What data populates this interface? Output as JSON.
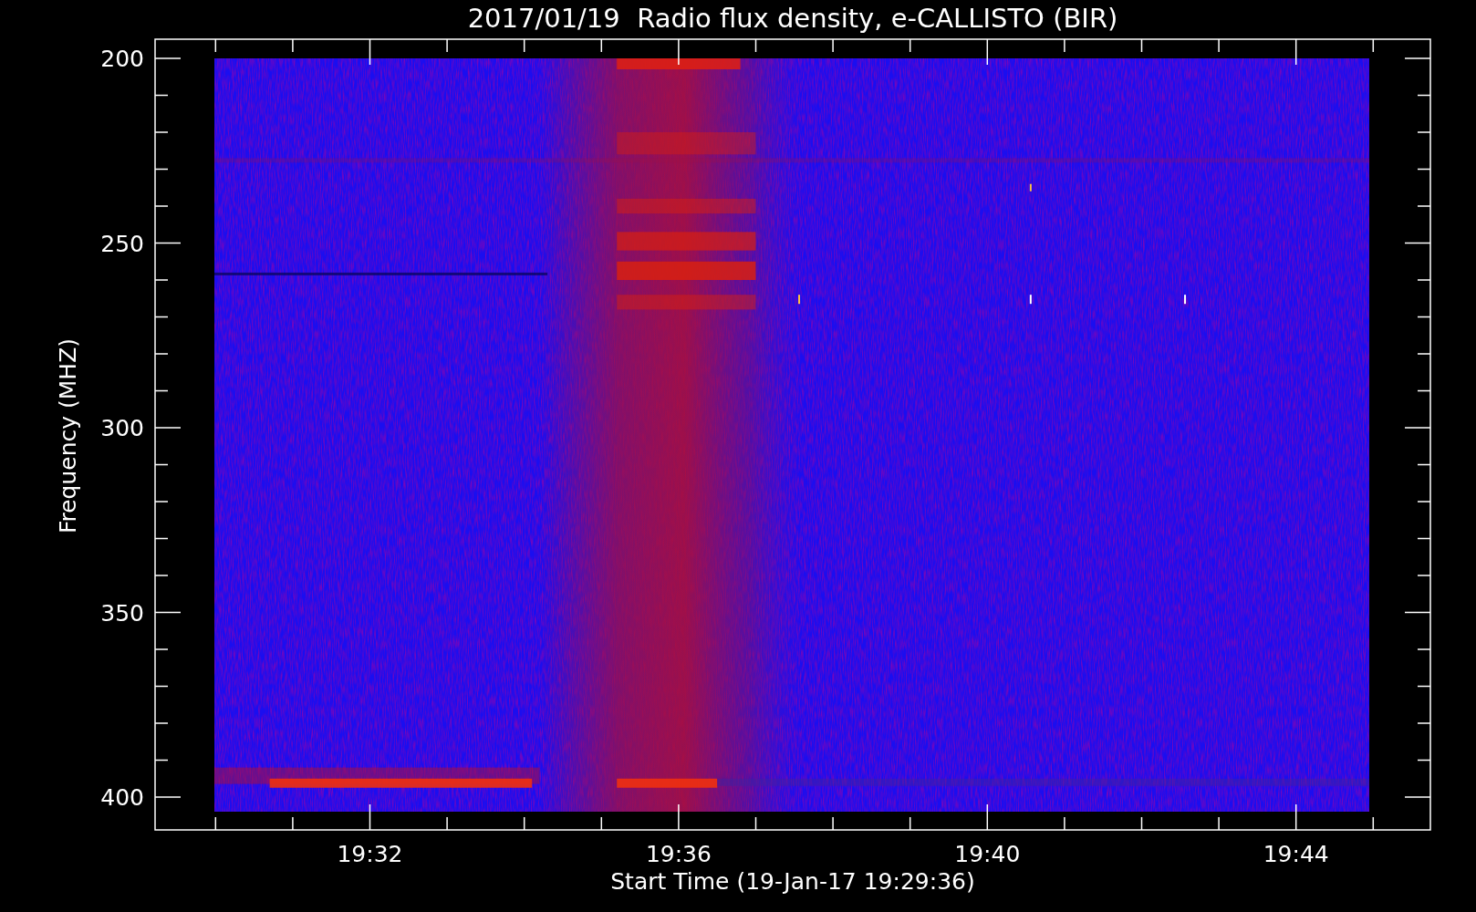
{
  "title": "2017/01/19  Radio flux density, e-CALLISTO (BIR)",
  "ylabel": "Frequency (MHZ)",
  "xlabel": "Start Time (19-Jan-17 19:29:36)",
  "yticks": [
    "200",
    "250",
    "300",
    "350",
    "400"
  ],
  "xticks": [
    "19:32",
    "19:36",
    "19:40",
    "19:44"
  ]
}
